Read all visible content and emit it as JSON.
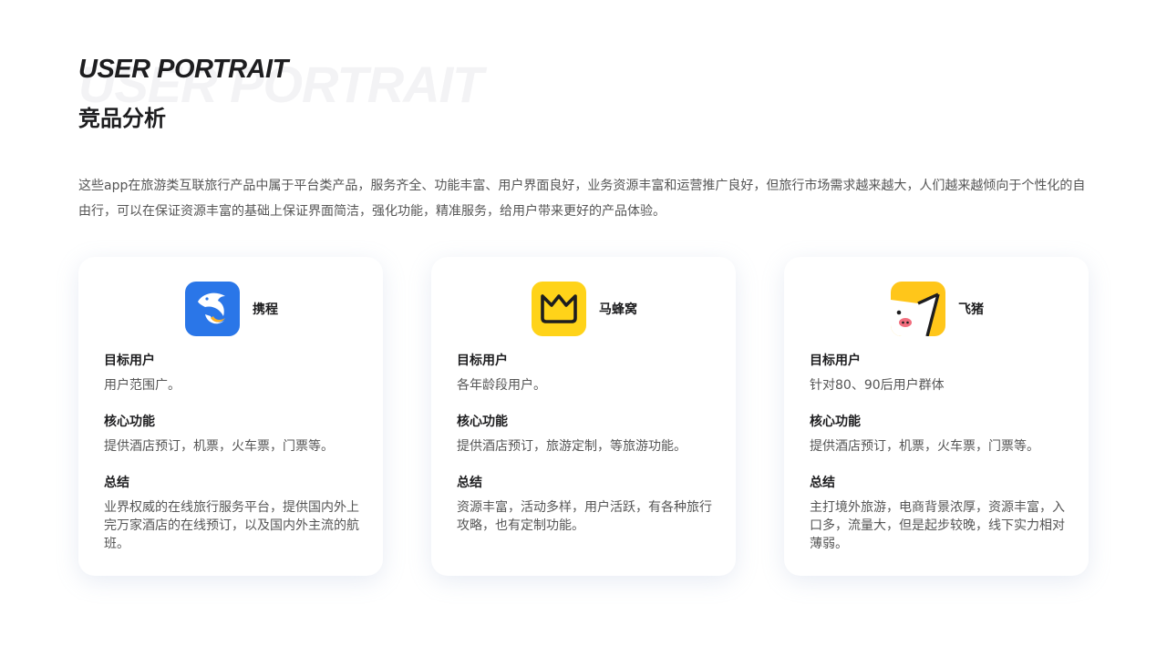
{
  "header": {
    "title_en": "USER PORTRAIT",
    "title_cn": "竞品分析"
  },
  "intro": "这些app在旅游类互联旅行产品中属于平台类产品，服务齐全、功能丰富、用户界面良好，业务资源丰富和运营推广良好，但旅行市场需求越来越大，人们越来越倾向于个性化的自由行，可以在保证资源丰富的基础上保证界面简洁，强化功能，精准服务，给用户带来更好的产品体验。",
  "colors": {
    "ctrip_blue": "#2a76e8",
    "mafengwo_yellow": "#ffd319",
    "fliggy_yellow": "#ffc61a"
  },
  "cards": [
    {
      "name": "携程",
      "icon": "dolphin-icon",
      "sections": [
        {
          "title": "目标用户",
          "text": "用户范围广。"
        },
        {
          "title": "核心功能",
          "text": "提供酒店预订，机票，火车票，门票等。"
        },
        {
          "title": "总结",
          "text": "业界权威的在线旅行服务平台，提供国内外上完万家酒店的在线预订，以及国内外主流的航班。"
        }
      ]
    },
    {
      "name": "马蜂窝",
      "icon": "mafengwo-m-icon",
      "sections": [
        {
          "title": "目标用户",
          "text": "各年龄段用户。"
        },
        {
          "title": "核心功能",
          "text": "提供酒店预订，旅游定制，等旅游功能。"
        },
        {
          "title": "总结",
          "text": "资源丰富，活动多样，用户活跃，有各种旅行攻略，也有定制功能。"
        }
      ]
    },
    {
      "name": "飞猪",
      "icon": "pig-icon",
      "sections": [
        {
          "title": "目标用户",
          "text": "针对80、90后用户群体"
        },
        {
          "title": "核心功能",
          "text": "提供酒店预订，机票，火车票，门票等。"
        },
        {
          "title": "总结",
          "text": "主打境外旅游，电商背景浓厚，资源丰富，入口多，流量大，但是起步较晚，线下实力相对薄弱。"
        }
      ]
    }
  ]
}
